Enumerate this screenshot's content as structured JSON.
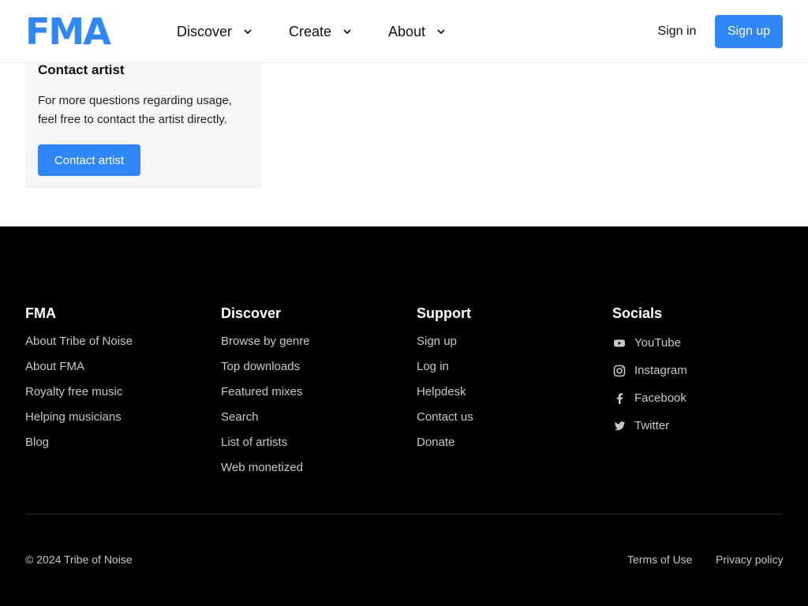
{
  "header": {
    "logo_text": "FMA",
    "nav": [
      {
        "label": "Discover"
      },
      {
        "label": "Create"
      },
      {
        "label": "About"
      }
    ],
    "sign_in": "Sign in",
    "sign_up": "Sign up"
  },
  "contact": {
    "title": "Contact artist",
    "text": "For more questions regarding usage, feel free to contact the artist directly.",
    "button": "Contact artist"
  },
  "footer": {
    "columns": [
      {
        "title": "FMA",
        "links": [
          "About Tribe of Noise",
          "About FMA",
          "Royalty free music",
          "Helping musicians",
          "Blog"
        ]
      },
      {
        "title": "Discover",
        "links": [
          "Browse by genre",
          "Top downloads",
          "Featured mixes",
          "Search",
          "List of artists",
          "Web monetized"
        ]
      },
      {
        "title": "Support",
        "links": [
          "Sign up",
          "Log in",
          "Helpdesk",
          "Contact us",
          "Donate"
        ]
      }
    ],
    "socials": {
      "title": "Socials",
      "items": [
        {
          "label": "YouTube",
          "icon": "youtube-icon"
        },
        {
          "label": "Instagram",
          "icon": "instagram-icon"
        },
        {
          "label": "Facebook",
          "icon": "facebook-icon"
        },
        {
          "label": "Twitter",
          "icon": "twitter-icon"
        }
      ]
    },
    "copyright": "© 2024 Tribe of Noise",
    "terms": "Terms of Use",
    "privacy": "Privacy policy"
  },
  "colors": {
    "accent": "#2f86f6",
    "footer_bg": "#000000",
    "card_bg": "#f6f6f6"
  }
}
